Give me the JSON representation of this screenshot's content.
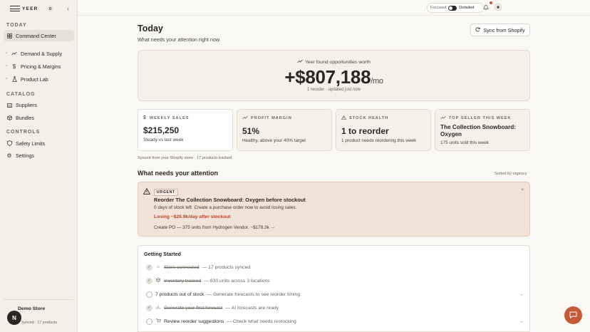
{
  "brand": {
    "name": "YEER",
    "org_badge": "0"
  },
  "sidebar": {
    "today_label": "TODAY",
    "today_items": [
      {
        "label": "Command Center",
        "icon": "grid-icon"
      }
    ],
    "groups": [
      {
        "label": "Demand & Supply",
        "icon": "trend-icon"
      },
      {
        "label": "Pricing & Margins",
        "icon": "dollar-icon"
      },
      {
        "label": "Product Lab",
        "icon": "flask-icon"
      }
    ],
    "catalog_label": "CATALOG",
    "catalog_items": [
      {
        "label": "Suppliers",
        "icon": "building-icon"
      },
      {
        "label": "Bundles",
        "icon": "box-icon"
      }
    ],
    "controls_label": "CONTROLS",
    "control_items": [
      {
        "label": "Safety Limits",
        "icon": "shield-icon"
      },
      {
        "label": "Settings",
        "icon": "gear-icon"
      }
    ],
    "store_name": "Demo Store",
    "store_status": "Synced · 17 products",
    "avatar_initial": "N"
  },
  "topbar": {
    "focused": "Focused",
    "detailed": "Detailed"
  },
  "header": {
    "title": "Today",
    "subtitle": "What needs your attention right now.",
    "sync_button": "Sync from Shopify"
  },
  "hero": {
    "caption": "Yeer found opportunities worth",
    "value": "+$807,188",
    "unit": "/mo",
    "meta": "1 reorder · updated just now"
  },
  "stats": [
    {
      "label": "WEEKLY SALES",
      "icon": "dollar-icon",
      "value": "$215,250",
      "note": "Steady vs last week"
    },
    {
      "label": "PROFIT MARGIN",
      "icon": "trend-icon",
      "value": "51%",
      "note": "Healthy, above your 40% target"
    },
    {
      "label": "STOCK HEALTH",
      "icon": "warning-icon",
      "value": "1 to reorder",
      "note": "1 product needs reordering this week"
    },
    {
      "label": "TOP SELLER THIS WEEK",
      "icon": "trend-icon",
      "value": "The Collection Snowboard: Oxygen",
      "note": "175 units sold this week"
    }
  ],
  "synced_note": "Synced from your Shopify store · 17 products tracked.",
  "attention": {
    "title": "What needs your attention",
    "sorted": "Sorted by urgency",
    "alert": {
      "badge": "URGENT",
      "close": "×",
      "title": "Reorder The Collection Snowboard: Oxygen before stockout",
      "desc": "0 days of stock left. Create a purchase order now to avoid losing sales.",
      "loss": "Losing ~$26.9k/day after stockout",
      "link": "Create PO — 375 units from Hydrogen Vendor, ~$178.3k →"
    }
  },
  "getting_started": {
    "title": "Getting Started",
    "rows": [
      {
        "label": "Store connected",
        "detail": "— 17 products synced",
        "done": true,
        "icon": "store-icon"
      },
      {
        "label": "Inventory tracked",
        "detail": "— 630 units across 3 locations",
        "done": true,
        "icon": "box-icon"
      },
      {
        "label": "7 products out of stock",
        "detail": "— Generate forecasts to see reorder timing",
        "done": false,
        "icon": "",
        "arrow": "→"
      },
      {
        "label": "Generate your first forecast",
        "detail": "— AI forecasts are ready",
        "done": true,
        "icon": "chart-icon"
      },
      {
        "label": "Review reorder suggestions",
        "detail": "— Check what needs restocking",
        "done": false,
        "icon": "cart-icon",
        "arrow": "→"
      }
    ]
  },
  "colors": {
    "accent": "#c65a38",
    "urgent": "#b2452f",
    "alert_bg": "#f2e3d9"
  }
}
